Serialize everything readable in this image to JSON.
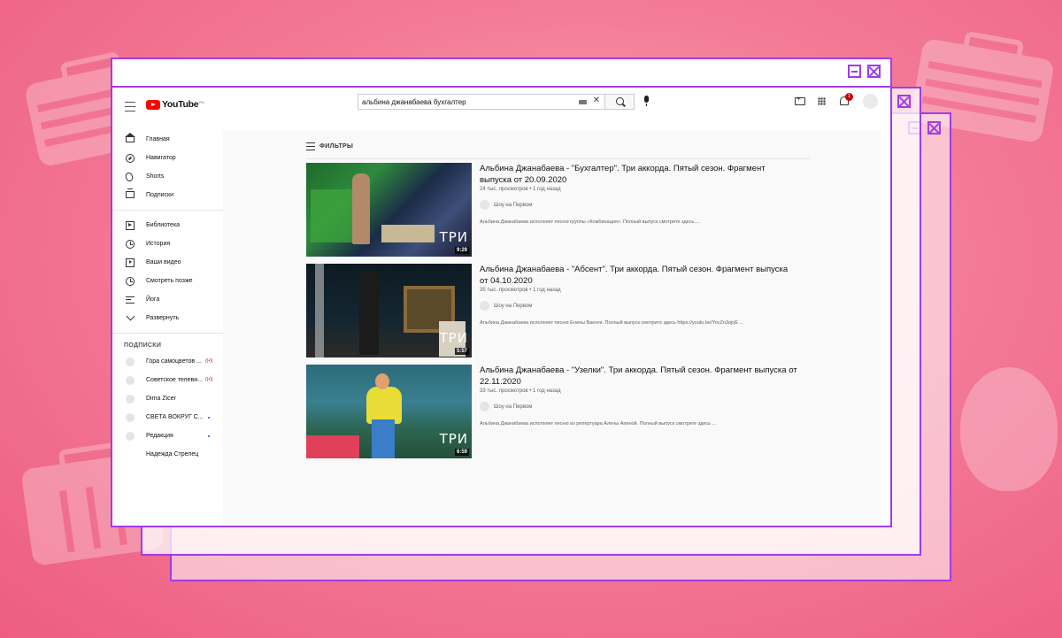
{
  "search": {
    "query": "альбина джанабаева бухгалтер"
  },
  "brand": {
    "logo_text": "YouTube",
    "region": "RU"
  },
  "notifications": {
    "count": "1"
  },
  "sidebar": {
    "items": [
      {
        "label": "Главная",
        "icon": "home-icon"
      },
      {
        "label": "Навигатор",
        "icon": "compass-icon"
      },
      {
        "label": "Shorts",
        "icon": "shorts-icon"
      },
      {
        "label": "Подписки",
        "icon": "subscriptions-icon"
      },
      {
        "label": "Библиотека",
        "icon": "library-icon"
      },
      {
        "label": "История",
        "icon": "history-icon"
      },
      {
        "label": "Ваши видео",
        "icon": "your-videos-icon"
      },
      {
        "label": "Смотреть позже",
        "icon": "watch-later-icon"
      },
      {
        "label": "Йога",
        "icon": "playlist-icon"
      },
      {
        "label": "Развернуть",
        "icon": "chevron-down-icon"
      }
    ],
    "subscriptions_title": "ПОДПИСКИ",
    "subscriptions": [
      {
        "name": "Гора самоцветов ..."
      },
      {
        "name": "Советское телеви..."
      },
      {
        "name": "Dima Zicer"
      },
      {
        "name": "СВЕТА ВОКРУГ С..."
      },
      {
        "name": "Редакция"
      },
      {
        "name": "Надежда Стрелец"
      }
    ]
  },
  "filters": {
    "label": "ФИЛЬТРЫ"
  },
  "results": [
    {
      "title": "Альбина Джанабаева - \"Бухгалтер\". Три аккорда. Пятый сезон. Фрагмент выпуска от 20.09.2020",
      "meta": "24 тыс. просмотров • 1 год назад",
      "channel": "Шоу на Первом",
      "description": "Альбина Джанабаева исполняет песню группы «Комбинация». Полный выпуск смотрите здесь ...",
      "duration": "9:29",
      "thumb_logo": "ТРИ"
    },
    {
      "title": "Альбина Джанабаева - \"Абсент\". Три аккорда. Пятый сезон. Фрагмент выпуска от 04.10.2020",
      "meta": "35 тыс. просмотров • 1 год назад",
      "channel": "Шоу на Первом",
      "description": "Альбина Джанабаева исполняет песню Елены Ваенги. Полный выпуск смотрите здесь https://youtu.be/YocZn3ojrjE ...",
      "duration": "5:57",
      "thumb_logo": "ТРИ"
    },
    {
      "title": "Альбина Джанабаева - \"Узелки\". Три аккорда. Пятый сезон. Фрагмент выпуска от 22.11.2020",
      "meta": "33 тыс. просмотров • 1 год назад",
      "channel": "Шоу на Первом",
      "description": "Альбина Джанабаева исполняет песню из репертуара Алены Апиной. Полный выпуск смотрите здесь ...",
      "duration": "6:59",
      "thumb_logo": "ТРИ"
    }
  ],
  "colors": {
    "frame_border": "#a13ce8",
    "brand_red": "#ff0000",
    "background_pink": "#f37c98"
  }
}
